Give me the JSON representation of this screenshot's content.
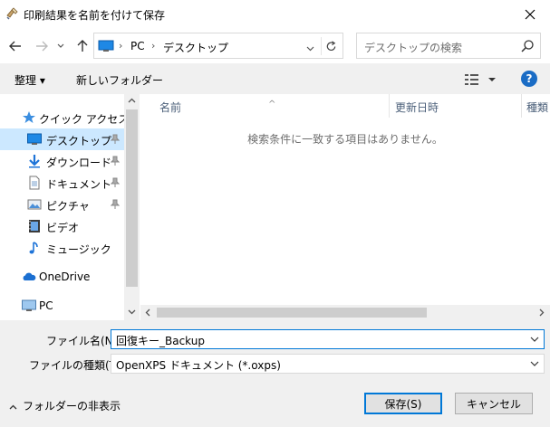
{
  "window": {
    "title": "印刷結果を名前を付けて保存"
  },
  "nav": {
    "breadcrumb": [
      "PC",
      "デスクトップ"
    ],
    "search_placeholder": "デスクトップの検索"
  },
  "toolbar": {
    "organize": "整理 ▾",
    "new_folder": "新しいフォルダー"
  },
  "sidebar": {
    "quick_access": "クイック アクセス",
    "items": [
      {
        "label": "デスクトップ",
        "icon": "desktop-icon",
        "pinned": true
      },
      {
        "label": "ダウンロード",
        "icon": "download-icon",
        "pinned": true
      },
      {
        "label": "ドキュメント",
        "icon": "document-icon",
        "pinned": true
      },
      {
        "label": "ピクチャ",
        "icon": "picture-icon",
        "pinned": true
      },
      {
        "label": "ビデオ",
        "icon": "video-icon",
        "pinned": false
      },
      {
        "label": "ミュージック",
        "icon": "music-icon",
        "pinned": false
      }
    ],
    "onedrive": "OneDrive",
    "pc": "PC"
  },
  "filelist": {
    "columns": [
      "名前",
      "更新日時",
      "種類"
    ],
    "empty_message": "検索条件に一致する項目はありません。"
  },
  "form": {
    "filename_label": "ファイル名(N):",
    "filename_value": "回復キー_Backup",
    "filetype_label": "ファイルの種類(T):",
    "filetype_value": "OpenXPS ドキュメント (*.oxps)"
  },
  "footer": {
    "hide_folders": "フォルダーの非表示",
    "save_button": "保存(S)",
    "cancel_button": "キャンセル"
  },
  "colors": {
    "accent": "#0078d7",
    "selected": "#cce8ff",
    "chrome": "#f0f0f0"
  }
}
